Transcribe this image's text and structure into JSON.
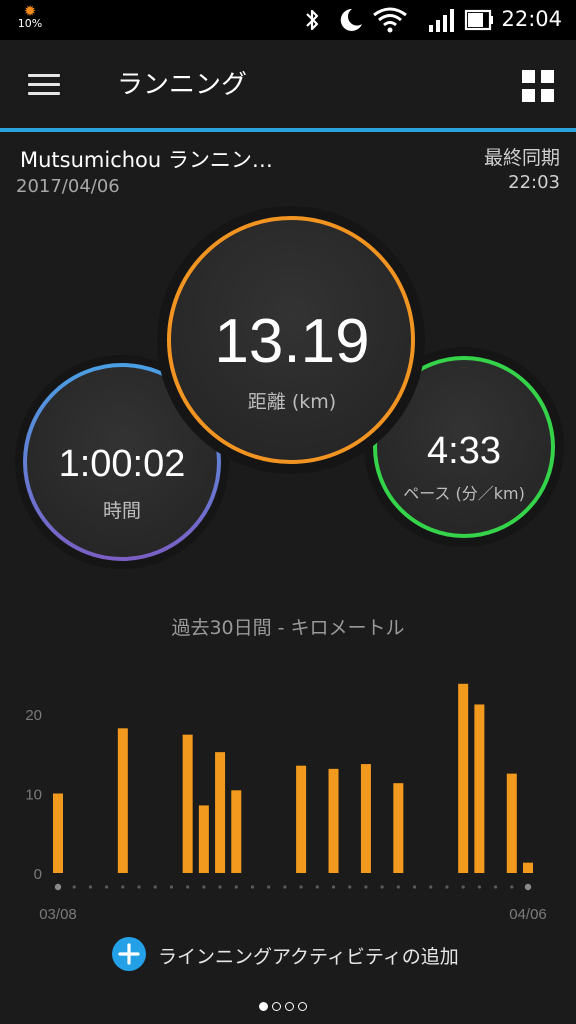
{
  "status_bar": {
    "battery_saver_pct": "10%",
    "time": "22:04",
    "icons": [
      "battery-saver-icon",
      "bluetooth-icon",
      "do-not-disturb-moon-icon",
      "wifi-icon",
      "signal-icon",
      "battery-icon"
    ]
  },
  "app_bar": {
    "title": "ランニング",
    "menu_icon": "hamburger-menu-icon",
    "view_icon": "grid-view-icon"
  },
  "activity": {
    "name": "Mutsumichou ランニン…",
    "date": "2017/04/06",
    "sync_label": "最終同期",
    "sync_time": "22:03"
  },
  "stats": {
    "distance": {
      "value": "13.19",
      "label": "距離 (km)",
      "color": "#f29421"
    },
    "time": {
      "value": "1:00:02",
      "label": "時間",
      "color_top": "#4a9fe4",
      "color_bottom": "#7b5fc4"
    },
    "pace": {
      "value": "4:33",
      "label": "ペース (分／km)",
      "color": "#35d34a"
    }
  },
  "chart_title": "過去30日間 - キロメートル",
  "chart_data": {
    "type": "bar",
    "x_start": "03/08",
    "x_end": "04/06",
    "days": 30,
    "values": [
      10,
      0,
      0,
      0,
      18.2,
      0,
      0,
      0,
      17.4,
      8.5,
      15.2,
      10.4,
      0,
      0,
      0,
      13.5,
      0,
      13.1,
      0,
      13.7,
      0,
      11.3,
      0,
      0,
      0,
      23.8,
      21.2,
      0,
      12.5,
      1.3
    ],
    "yticks": [
      0,
      10,
      20
    ],
    "ylim": [
      0,
      25
    ],
    "bar_color": "#f29a1d",
    "grid": false
  },
  "add_activity_label": "ラインニングアクティビティの追加",
  "page_indicator": {
    "count": 4,
    "active": 0
  }
}
